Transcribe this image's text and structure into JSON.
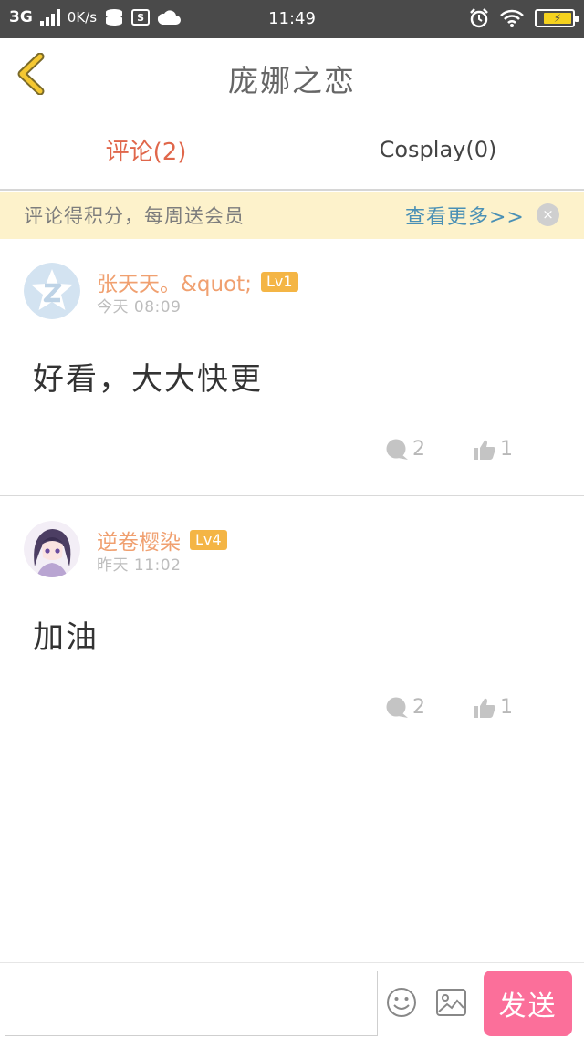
{
  "status_bar": {
    "network": "3G",
    "speed": "0K/s",
    "s_badge": "S",
    "time": "11:49",
    "icons": [
      "signal-icon",
      "data-icon",
      "s-icon",
      "cloud-icon",
      "alarm-icon",
      "wifi-icon",
      "battery-icon"
    ]
  },
  "header": {
    "title": "庞娜之恋",
    "back_icon": "chevron-left-icon"
  },
  "tabs": [
    {
      "label": "评论(2)",
      "active": true
    },
    {
      "label": "Cosplay(0)",
      "active": false
    }
  ],
  "banner": {
    "text": "评论得积分，每周送会员",
    "link": "查看更多>>",
    "close": "×"
  },
  "comments": [
    {
      "user": "张天天。&quot;",
      "level": "Lv1",
      "time": "今天 08:09",
      "text": "好看，大大快更",
      "replies": "2",
      "likes": "1",
      "avatar": "qq-default-avatar"
    },
    {
      "user": "逆卷樱染",
      "level": "Lv4",
      "time": "昨天 11:02",
      "text": "加油",
      "replies": "2",
      "likes": "1",
      "avatar": "anime-girl-avatar"
    }
  ],
  "composer": {
    "placeholder": "",
    "send_label": "发送",
    "icons": [
      "emoji-icon",
      "image-icon"
    ]
  },
  "colors": {
    "accent_tab": "#e0674b",
    "banner_bg": "#fdf2cb",
    "link": "#4a90b5",
    "username": "#f0a070",
    "level_badge": "#f4b545",
    "send_button": "#fb6f9a"
  }
}
